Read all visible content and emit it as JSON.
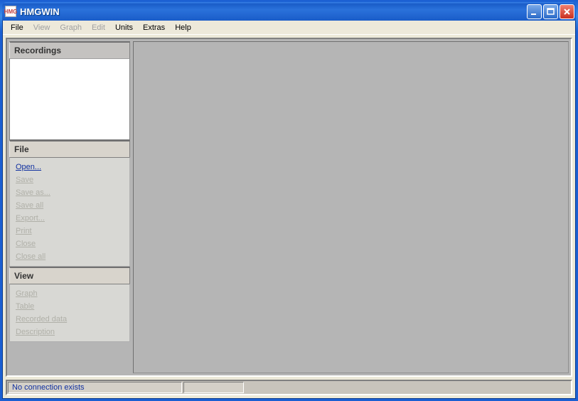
{
  "window": {
    "title": "HMGWIN",
    "icon_label": "HMG"
  },
  "menubar": {
    "items": [
      {
        "label": "File",
        "enabled": true
      },
      {
        "label": "View",
        "enabled": false
      },
      {
        "label": "Graph",
        "enabled": false
      },
      {
        "label": "Edit",
        "enabled": false
      },
      {
        "label": "Units",
        "enabled": true
      },
      {
        "label": "Extras",
        "enabled": true
      },
      {
        "label": "Help",
        "enabled": true
      }
    ]
  },
  "sidebar": {
    "recordings": {
      "header": "Recordings"
    },
    "file": {
      "header": "File",
      "items": [
        {
          "label": "Open...",
          "enabled": true
        },
        {
          "label": "Save",
          "enabled": false
        },
        {
          "label": "Save as...",
          "enabled": false
        },
        {
          "label": "Save all",
          "enabled": false
        },
        {
          "label": "Export...",
          "enabled": false
        },
        {
          "label": "Print",
          "enabled": false
        },
        {
          "label": "Close",
          "enabled": false
        },
        {
          "label": "Close all",
          "enabled": false
        }
      ]
    },
    "view": {
      "header": "View",
      "items": [
        {
          "label": "Graph",
          "enabled": false
        },
        {
          "label": "Table",
          "enabled": false
        },
        {
          "label": "Recorded data",
          "enabled": false
        },
        {
          "label": "Description",
          "enabled": false
        }
      ]
    }
  },
  "statusbar": {
    "connection": "No connection exists",
    "field2": ""
  }
}
